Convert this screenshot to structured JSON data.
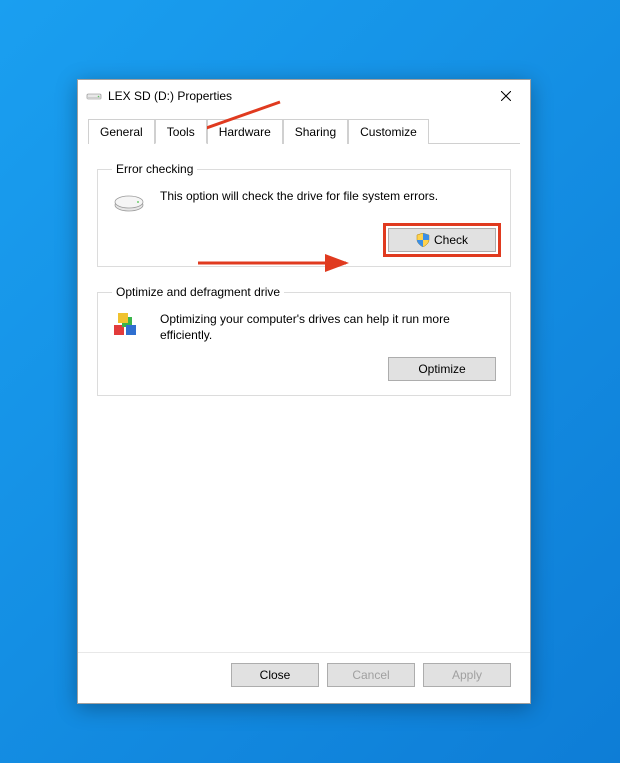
{
  "window": {
    "title": "LEX SD (D:) Properties"
  },
  "tabs": {
    "items": [
      {
        "label": "General"
      },
      {
        "label": "Tools"
      },
      {
        "label": "Hardware"
      },
      {
        "label": "Sharing"
      },
      {
        "label": "Customize"
      }
    ],
    "active_index": 1
  },
  "groups": {
    "error_checking": {
      "legend": "Error checking",
      "text": "This option will check the drive for file system errors.",
      "button": "Check"
    },
    "optimize": {
      "legend": "Optimize and defragment drive",
      "text": "Optimizing your computer's drives can help it run more efficiently.",
      "button": "Optimize"
    }
  },
  "buttons": {
    "close": "Close",
    "cancel": "Cancel",
    "apply": "Apply"
  },
  "annotation": {
    "color": "#e03a1f"
  }
}
